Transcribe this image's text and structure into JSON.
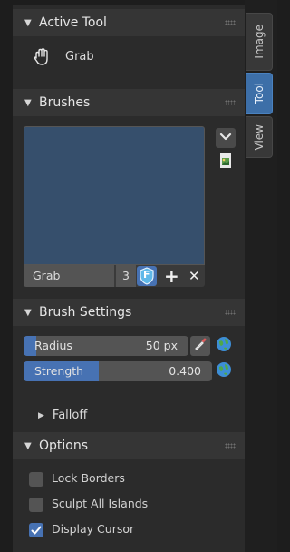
{
  "sidebar_tabs": [
    {
      "label": "Image",
      "active": false
    },
    {
      "label": "Tool",
      "active": true
    },
    {
      "label": "View",
      "active": false
    }
  ],
  "active_tool": {
    "title": "Active Tool",
    "tool_label": "Grab",
    "tool_icon": "hand-grab-icon"
  },
  "brushes": {
    "title": "Brushes",
    "brush_name": "Grab",
    "user_count": "3",
    "fake_user_label": "F",
    "add_label": "+",
    "remove_label": "✕"
  },
  "brush_settings": {
    "title": "Brush Settings",
    "radius": {
      "label": "Radius",
      "value": "50 px"
    },
    "strength": {
      "label": "Strength",
      "value": "0.400",
      "fraction": 0.4
    },
    "falloff_label": "Falloff"
  },
  "options": {
    "title": "Options",
    "items": [
      {
        "label": "Lock Borders",
        "checked": false
      },
      {
        "label": "Sculpt All Islands",
        "checked": false
      },
      {
        "label": "Display Cursor",
        "checked": true
      }
    ]
  },
  "colors": {
    "accent": "#4772b3",
    "panel_bg": "#2b2b2b",
    "header_bg": "#353535",
    "preview_bg": "#364f6c"
  }
}
